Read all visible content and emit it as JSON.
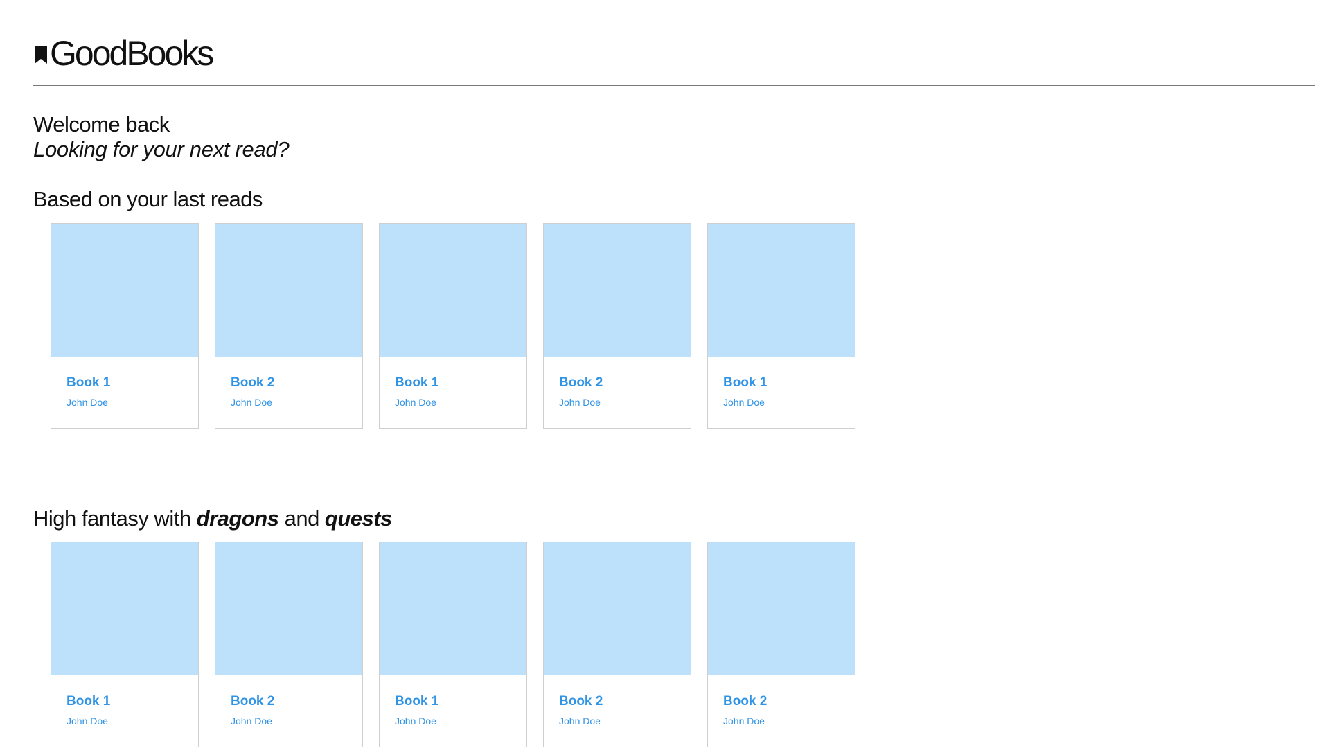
{
  "app": {
    "logo_text": "GoodBooks"
  },
  "greeting": {
    "welcome": "Welcome back",
    "tagline": "Looking for your next read?"
  },
  "sections": [
    {
      "title": "Based on your last reads",
      "books": [
        {
          "title": "Book 1",
          "author": "John Doe"
        },
        {
          "title": "Book 2",
          "author": "John Doe"
        },
        {
          "title": "Book 1",
          "author": "John Doe"
        },
        {
          "title": "Book 2",
          "author": "John Doe"
        },
        {
          "title": "Book 1",
          "author": "John Doe"
        }
      ]
    },
    {
      "title_parts": [
        "High fantasy with ",
        "dragons",
        " and ",
        "quests"
      ],
      "books": [
        {
          "title": "Book 1",
          "author": "John Doe"
        },
        {
          "title": "Book 2",
          "author": "John Doe"
        },
        {
          "title": "Book 1",
          "author": "John Doe"
        },
        {
          "title": "Book 2",
          "author": "John Doe"
        },
        {
          "title": "Book 2",
          "author": "John Doe"
        }
      ]
    }
  ],
  "colors": {
    "accent": "#2f93e6",
    "cover_placeholder": "#bde0fb",
    "divider": "#7a7a7a"
  }
}
